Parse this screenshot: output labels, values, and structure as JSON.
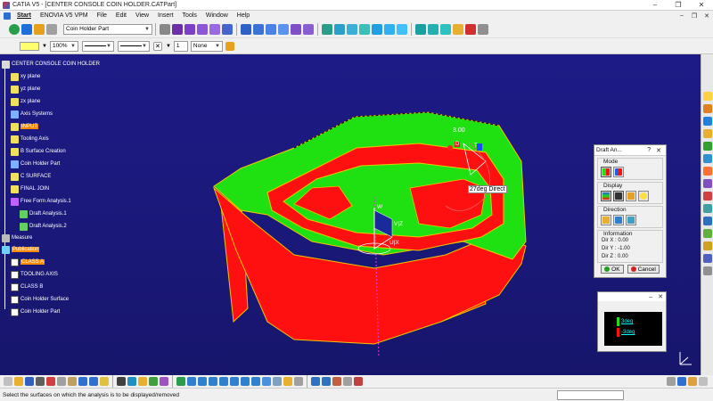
{
  "window": {
    "title": "CATIA V5 - [CENTER CONSOLE COIN HOLDER.CATPart]",
    "controls": [
      "–",
      "❐",
      "✕"
    ]
  },
  "menubar": {
    "items": [
      "Start",
      "ENOVIA V5 VPM",
      "File",
      "Edit",
      "View",
      "Insert",
      "Tools",
      "Window",
      "Help"
    ],
    "right_controls": [
      "–",
      "❐",
      "✕"
    ]
  },
  "toolbar2": {
    "current_set": "Coin Holder Part",
    "zoom": "100%",
    "layer": "None",
    "number": "1"
  },
  "tree": {
    "items": [
      {
        "label": "CENTER CONSOLE COIN HOLDER",
        "icon": "part-icon",
        "color": "#d9d9d9"
      },
      {
        "label": "xy plane",
        "icon": "plane-icon",
        "color": "#f0e060"
      },
      {
        "label": "yz plane",
        "icon": "plane-icon",
        "color": "#f0e060"
      },
      {
        "label": "zx plane",
        "icon": "plane-icon",
        "color": "#f0e060"
      },
      {
        "label": "Axis Systems",
        "icon": "axis-icon",
        "color": "#7fb0ff"
      },
      {
        "label": "INPUT",
        "icon": "set-icon",
        "color": "#f0e060",
        "highlight": true
      },
      {
        "label": "Tooling Axis",
        "icon": "set-icon",
        "color": "#f0e060"
      },
      {
        "label": "B Surface Creation",
        "icon": "set-icon",
        "color": "#f0e060"
      },
      {
        "label": "Coin Holder Part",
        "icon": "body-icon",
        "color": "#7fb0ff"
      },
      {
        "label": "C SURFACE",
        "icon": "set-icon",
        "color": "#f0e060"
      },
      {
        "label": "FINAL JOIN",
        "icon": "set-icon",
        "color": "#f0e060"
      },
      {
        "label": "Free Form Analysis.1",
        "icon": "analysis-icon",
        "color": "#c060ff"
      },
      {
        "label": "Draft Analysis.1",
        "icon": "draft-icon",
        "color": "#60d060"
      },
      {
        "label": "Draft Analysis.2",
        "icon": "draft-icon",
        "color": "#60d060"
      },
      {
        "label": "Measure",
        "icon": "measure-icon",
        "color": "#bbbbbb"
      },
      {
        "label": "Publication",
        "icon": "publication-icon",
        "color": "#70d0ff",
        "highlight": true
      },
      {
        "label": "CLASS A",
        "icon": "pub-item-icon",
        "color": "#ffffff",
        "highlight": true
      },
      {
        "label": "TOOLING AXIS",
        "icon": "pub-item-icon",
        "color": "#ffffff"
      },
      {
        "label": "CLASS B",
        "icon": "pub-item-icon",
        "color": "#ffffff"
      },
      {
        "label": "Coin Holder Surface",
        "icon": "pub-item-icon",
        "color": "#ffffff"
      },
      {
        "label": "Coin Holder Part",
        "icon": "pub-item-icon",
        "color": "#ffffff"
      }
    ]
  },
  "viewport": {
    "direction_tag": "27deg Direct",
    "angle_value": "3.00",
    "axis_labels": {
      "w": "W",
      "vz": "V|Z",
      "ux": "U|X"
    },
    "axis_letters": {
      "d": "D",
      "t": "T"
    },
    "colors": {
      "positive": "#1fe010",
      "negative": "#ff1010",
      "edge": "#f2c400"
    }
  },
  "draft_panel": {
    "title": "Draft An...",
    "help": "?",
    "close": "✕",
    "mode_label": "Mode",
    "display_label": "Display",
    "direction_label": "Direction",
    "information_label": "Information",
    "dir_x": "Dir X : 0.00",
    "dir_y": "Dir Y : -1.00",
    "dir_z": "Dir Z : 0.00",
    "ok_label": "OK",
    "cancel_label": "Cancel"
  },
  "scale_panel": {
    "min_label": "–",
    "close": "✕",
    "entries": [
      {
        "text": "3deg",
        "color": "#1fe010"
      },
      {
        "text": "-3deg",
        "color": "#ff1010"
      }
    ]
  },
  "statusbar": {
    "text": "Select the surfaces on which the analysis is to be displayed/removed"
  }
}
